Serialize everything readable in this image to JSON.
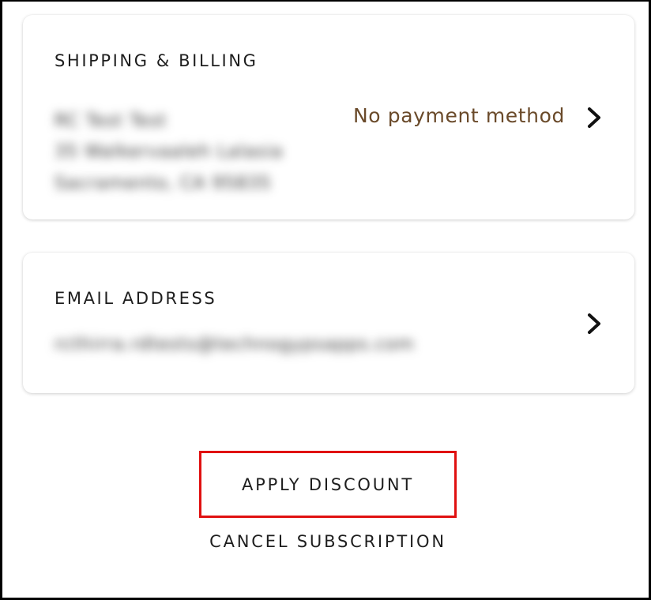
{
  "shipping_billing": {
    "title": "SHIPPING & BILLING",
    "address_lines": [
      "RC Test Test",
      "35 Walkervaaleh Lalasia",
      "Sacramento, CA 95835"
    ],
    "payment_status": "No payment method",
    "status_color": "#6a4a2a"
  },
  "email": {
    "title": "EMAIL ADDRESS",
    "value": "rcthirra.rdtests@technogypsapps.com"
  },
  "actions": {
    "apply_discount": "APPLY DISCOUNT",
    "cancel_subscription": "CANCEL SUBSCRIPTION",
    "highlight_color": "#e01010"
  },
  "icons": {
    "chevron": "chevron-right-icon"
  }
}
